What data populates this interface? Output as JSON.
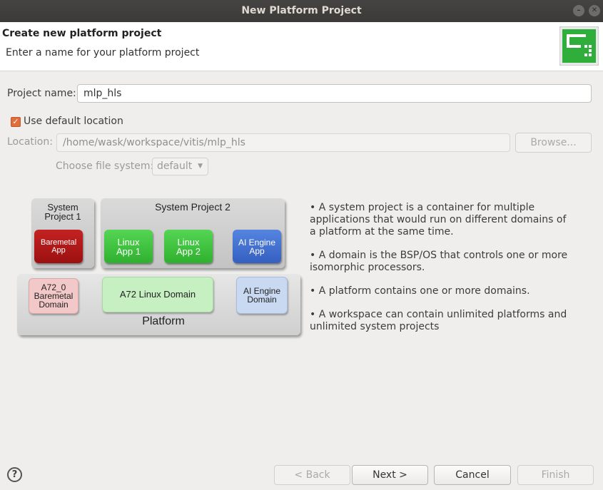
{
  "window": {
    "title": "New Platform Project"
  },
  "header": {
    "title": "Create new platform project",
    "subtitle": "Enter a name for your platform project"
  },
  "form": {
    "project_name_label": "Project name:",
    "project_name_value": "mlp_hls",
    "use_default_label": "Use default location",
    "use_default_checked": true,
    "location_label": "Location:",
    "location_value": "/home/wask/workspace/vitis/mlp_hls",
    "browse_label": "Browse...",
    "filesystem_label": "Choose file system:",
    "filesystem_value": "default"
  },
  "diagram": {
    "system_project_1": "System Project 1",
    "system_project_2": "System Project 2",
    "baremetal_app": "Baremetal App",
    "linux_app_1": "Linux App 1",
    "linux_app_2": "Linux App 2",
    "ai_engine_app": "AI Engine App",
    "a72_0_baremetal_domain": "A72_0 Baremetal Domain",
    "a72_linux_domain": "A72 Linux Domain",
    "ai_engine_domain": "AI Engine Domain",
    "platform": "Platform"
  },
  "info": [
    "• A system project is a container for multiple applications that would run on different domains of a platform at the same time.",
    "• A domain is the BSP/OS that controls one or more isomorphic processors.",
    "• A platform contains one or more domains.",
    "• A workspace can contain unlimited platforms and unlimited system projects"
  ],
  "buttons": {
    "help": "?",
    "back": "< Back",
    "next": "Next >",
    "cancel": "Cancel",
    "finish": "Finish"
  },
  "colors": {
    "checkbox_accent": "#e06e3c",
    "baremetal_app": "#b01818",
    "linux_app": "#3cc43c",
    "ai_engine_app": "#3f6fd0",
    "baremetal_domain": "#f2c8c8",
    "linux_domain": "#c6f0c2",
    "ai_engine_domain": "#c9d9f2"
  }
}
